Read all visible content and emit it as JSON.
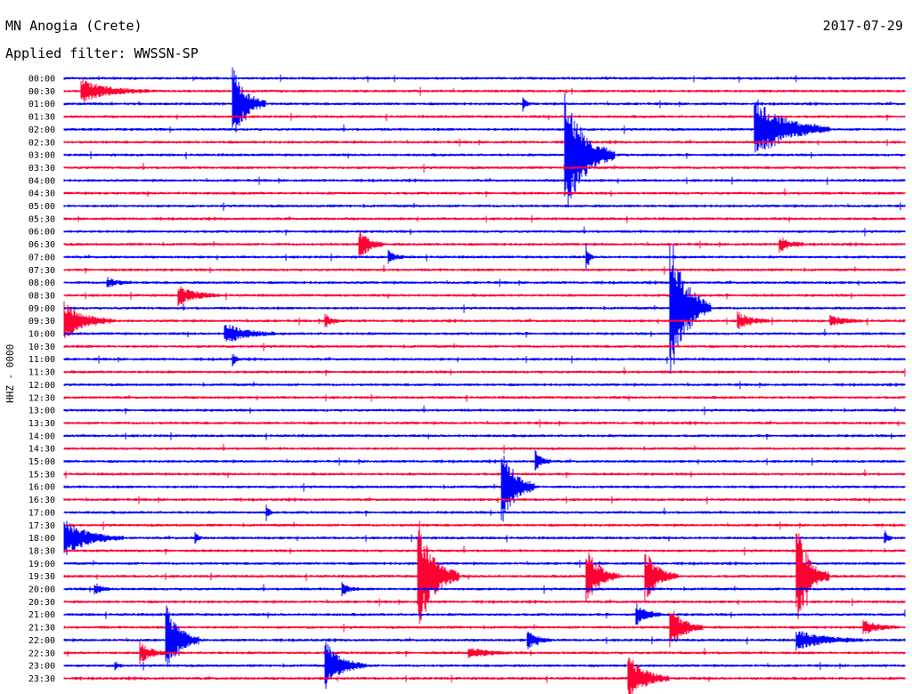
{
  "header": {
    "station": "MN Anogia (Crete)",
    "date": "2017-07-29",
    "filter": "Applied filter: WWSSN-SP"
  },
  "chart_data": {
    "type": "line",
    "ylabel": "HHZ - 0000",
    "colors": {
      "blue": "#0000ff",
      "red": "#ff0033"
    },
    "rows": [
      {
        "label": "00:00",
        "color": "blue"
      },
      {
        "label": "00:30",
        "color": "red"
      },
      {
        "label": "01:00",
        "color": "blue"
      },
      {
        "label": "01:30",
        "color": "red"
      },
      {
        "label": "02:00",
        "color": "blue"
      },
      {
        "label": "02:30",
        "color": "red"
      },
      {
        "label": "03:00",
        "color": "blue"
      },
      {
        "label": "03:30",
        "color": "red"
      },
      {
        "label": "04:00",
        "color": "blue"
      },
      {
        "label": "04:30",
        "color": "red"
      },
      {
        "label": "05:00",
        "color": "blue"
      },
      {
        "label": "05:30",
        "color": "red"
      },
      {
        "label": "06:00",
        "color": "blue"
      },
      {
        "label": "06:30",
        "color": "red"
      },
      {
        "label": "07:00",
        "color": "blue"
      },
      {
        "label": "07:30",
        "color": "red"
      },
      {
        "label": "08:00",
        "color": "blue"
      },
      {
        "label": "08:30",
        "color": "red"
      },
      {
        "label": "09:00",
        "color": "blue"
      },
      {
        "label": "09:30",
        "color": "red"
      },
      {
        "label": "10:00",
        "color": "blue"
      },
      {
        "label": "10:30",
        "color": "red"
      },
      {
        "label": "11:00",
        "color": "blue"
      },
      {
        "label": "11:30",
        "color": "red"
      },
      {
        "label": "12:00",
        "color": "blue"
      },
      {
        "label": "12:30",
        "color": "red"
      },
      {
        "label": "13:00",
        "color": "blue"
      },
      {
        "label": "13:30",
        "color": "red"
      },
      {
        "label": "14:00",
        "color": "blue"
      },
      {
        "label": "14:30",
        "color": "red"
      },
      {
        "label": "15:00",
        "color": "blue"
      },
      {
        "label": "15:30",
        "color": "red"
      },
      {
        "label": "16:00",
        "color": "blue"
      },
      {
        "label": "16:30",
        "color": "red"
      },
      {
        "label": "17:00",
        "color": "blue"
      },
      {
        "label": "17:30",
        "color": "red"
      },
      {
        "label": "18:00",
        "color": "blue"
      },
      {
        "label": "18:30",
        "color": "red"
      },
      {
        "label": "19:00",
        "color": "blue"
      },
      {
        "label": "19:30",
        "color": "red"
      },
      {
        "label": "20:00",
        "color": "blue"
      },
      {
        "label": "20:30",
        "color": "red"
      },
      {
        "label": "21:00",
        "color": "blue"
      },
      {
        "label": "21:30",
        "color": "red"
      },
      {
        "label": "22:00",
        "color": "blue"
      },
      {
        "label": "22:30",
        "color": "red"
      },
      {
        "label": "23:00",
        "color": "blue"
      },
      {
        "label": "23:30",
        "color": "red"
      }
    ],
    "events": [
      {
        "row": 1,
        "t": 0.02,
        "amp": 1.0,
        "dur": 0.08
      },
      {
        "row": 2,
        "t": 0.2,
        "amp": 3.5,
        "dur": 0.04
      },
      {
        "row": 2,
        "t": 0.545,
        "amp": 0.7,
        "dur": 0.01
      },
      {
        "row": 4,
        "t": 0.82,
        "amp": 3.0,
        "dur": 0.09
      },
      {
        "row": 6,
        "t": 0.595,
        "amp": 6.0,
        "dur": 0.06
      },
      {
        "row": 13,
        "t": 0.35,
        "amp": 1.5,
        "dur": 0.03
      },
      {
        "row": 13,
        "t": 0.85,
        "amp": 0.8,
        "dur": 0.03
      },
      {
        "row": 14,
        "t": 0.62,
        "amp": 1.3,
        "dur": 0.01
      },
      {
        "row": 14,
        "t": 0.385,
        "amp": 0.6,
        "dur": 0.02
      },
      {
        "row": 16,
        "t": 0.05,
        "amp": 0.5,
        "dur": 0.03
      },
      {
        "row": 17,
        "t": 0.135,
        "amp": 0.9,
        "dur": 0.05
      },
      {
        "row": 18,
        "t": 0.72,
        "amp": 7.0,
        "dur": 0.05
      },
      {
        "row": 19,
        "t": 0.0,
        "amp": 1.6,
        "dur": 0.06
      },
      {
        "row": 19,
        "t": 0.31,
        "amp": 0.7,
        "dur": 0.02
      },
      {
        "row": 19,
        "t": 0.8,
        "amp": 0.8,
        "dur": 0.04
      },
      {
        "row": 19,
        "t": 0.91,
        "amp": 0.5,
        "dur": 0.04
      },
      {
        "row": 20,
        "t": 0.19,
        "amp": 1.0,
        "dur": 0.06
      },
      {
        "row": 22,
        "t": 0.2,
        "amp": 0.6,
        "dur": 0.01
      },
      {
        "row": 30,
        "t": 0.56,
        "amp": 1.0,
        "dur": 0.02
      },
      {
        "row": 32,
        "t": 0.52,
        "amp": 4.0,
        "dur": 0.04
      },
      {
        "row": 34,
        "t": 0.24,
        "amp": 0.8,
        "dur": 0.01
      },
      {
        "row": 36,
        "t": 0.0,
        "amp": 1.6,
        "dur": 0.07
      },
      {
        "row": 36,
        "t": 0.155,
        "amp": 0.6,
        "dur": 0.01
      },
      {
        "row": 36,
        "t": 0.975,
        "amp": 1.0,
        "dur": 0.01
      },
      {
        "row": 39,
        "t": 0.42,
        "amp": 5.5,
        "dur": 0.05
      },
      {
        "row": 39,
        "t": 0.62,
        "amp": 3.0,
        "dur": 0.04
      },
      {
        "row": 39,
        "t": 0.69,
        "amp": 2.6,
        "dur": 0.04
      },
      {
        "row": 39,
        "t": 0.87,
        "amp": 5.0,
        "dur": 0.04
      },
      {
        "row": 40,
        "t": 0.035,
        "amp": 0.7,
        "dur": 0.02
      },
      {
        "row": 40,
        "t": 0.33,
        "amp": 0.6,
        "dur": 0.02
      },
      {
        "row": 42,
        "t": 0.68,
        "amp": 1.0,
        "dur": 0.03
      },
      {
        "row": 43,
        "t": 0.72,
        "amp": 2.0,
        "dur": 0.04
      },
      {
        "row": 43,
        "t": 0.95,
        "amp": 0.7,
        "dur": 0.04
      },
      {
        "row": 44,
        "t": 0.12,
        "amp": 3.5,
        "dur": 0.04
      },
      {
        "row": 44,
        "t": 0.55,
        "amp": 0.9,
        "dur": 0.03
      },
      {
        "row": 44,
        "t": 0.87,
        "amp": 0.9,
        "dur": 0.08
      },
      {
        "row": 45,
        "t": 0.09,
        "amp": 1.0,
        "dur": 0.03
      },
      {
        "row": 45,
        "t": 0.48,
        "amp": 0.5,
        "dur": 0.05
      },
      {
        "row": 46,
        "t": 0.31,
        "amp": 2.2,
        "dur": 0.05
      },
      {
        "row": 46,
        "t": 0.06,
        "amp": 0.5,
        "dur": 0.01
      },
      {
        "row": 47,
        "t": 0.67,
        "amp": 2.2,
        "dur": 0.05
      }
    ]
  }
}
